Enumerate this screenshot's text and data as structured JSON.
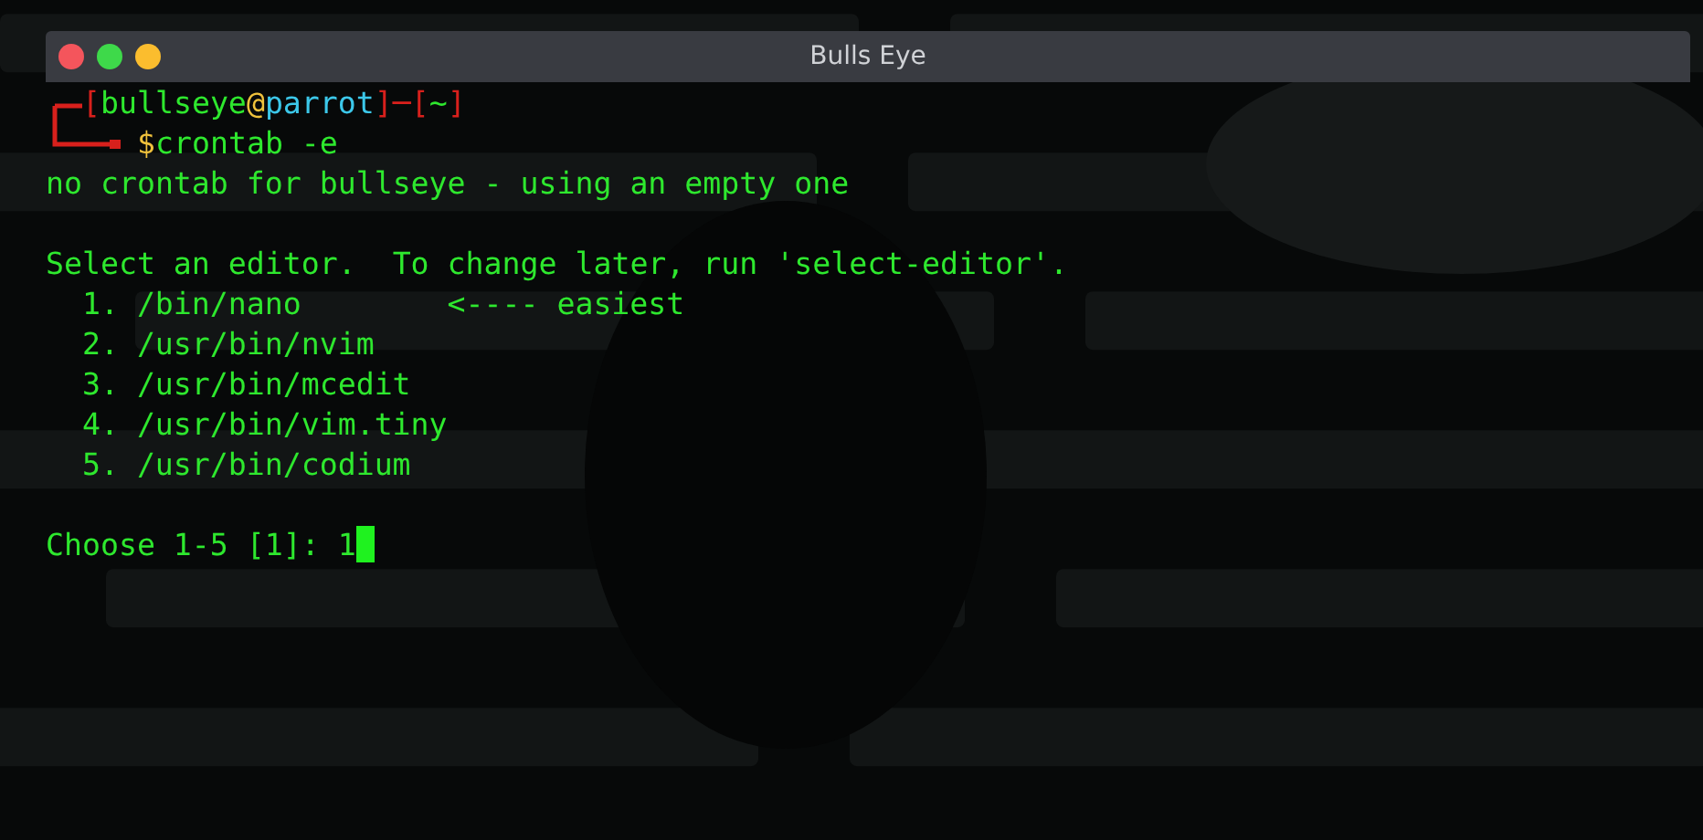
{
  "window": {
    "title": "Bulls Eye"
  },
  "prompt": {
    "segments": [
      {
        "text": "[",
        "kind": "frame"
      },
      {
        "text": "bullseye",
        "kind": "user"
      },
      {
        "text": "@",
        "kind": "at"
      },
      {
        "text": "parrot",
        "kind": "host"
      },
      {
        "text": "]─[",
        "kind": "frame"
      },
      {
        "text": "~",
        "kind": "cwd"
      },
      {
        "text": "]",
        "kind": "frame"
      }
    ],
    "command": [
      {
        "text": "$",
        "kind": "sign"
      },
      {
        "text": "crontab -e",
        "kind": "command"
      }
    ]
  },
  "notice": "no crontab for bullseye - using an empty one",
  "menu_heading": "Select an editor.  To change later, run 'select-editor'.",
  "editors": [
    {
      "item": "1. /bin/nano",
      "note": "<---- easiest"
    },
    {
      "item": "2. /usr/bin/nvim"
    },
    {
      "item": "3. /usr/bin/mcedit"
    },
    {
      "item": "4. /usr/bin/vim.tiny"
    },
    {
      "item": "5. /usr/bin/codium"
    }
  ],
  "choice": {
    "prompt": "Choose 1-5 [1]:",
    "value": "1"
  }
}
